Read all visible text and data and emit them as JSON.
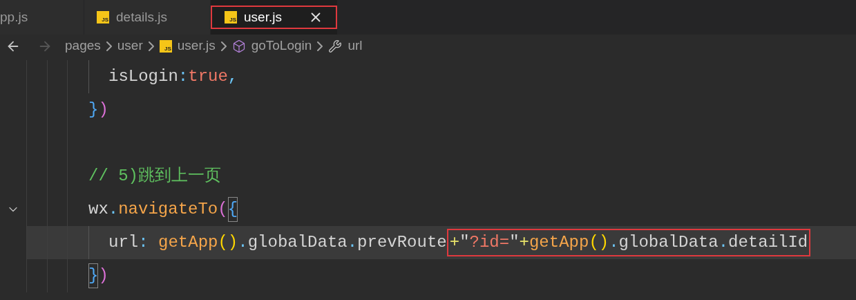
{
  "tabs": [
    {
      "label": "pp.js",
      "selected": false,
      "outlined": false
    },
    {
      "label": "details.js",
      "icon_label": "JS",
      "selected": false,
      "outlined": false
    },
    {
      "label": "user.js",
      "icon_label": "JS",
      "selected": true,
      "outlined": true
    }
  ],
  "nav": {
    "back_disabled": false,
    "forward_disabled": true
  },
  "breadcrumbs": [
    {
      "label": "pages",
      "kind": "folder"
    },
    {
      "label": "user",
      "kind": "folder"
    },
    {
      "label": "user.js",
      "kind": "file",
      "icon_label": "JS"
    },
    {
      "label": "goToLogin",
      "kind": "method"
    },
    {
      "label": "url",
      "kind": "property"
    }
  ],
  "code_lines": [
    {
      "kind": "code",
      "tokens": [
        {
          "kind": "indent"
        },
        {
          "kind": "plain",
          "text": "isLogin"
        },
        {
          "kind": "punct",
          "text": ":"
        },
        {
          "kind": "keyword",
          "text": "true"
        },
        {
          "kind": "punct",
          "text": ","
        }
      ]
    },
    {
      "kind": "code",
      "tokens": [
        {
          "kind": "b3",
          "text": "}"
        },
        {
          "kind": "b2",
          "text": ")"
        }
      ]
    },
    {
      "kind": "blank"
    },
    {
      "kind": "code",
      "tokens": [
        {
          "kind": "comment",
          "text": "// 5)跳到上一页"
        }
      ]
    },
    {
      "kind": "code",
      "fold": true,
      "tokens": [
        {
          "kind": "plain",
          "text": "wx"
        },
        {
          "kind": "punct",
          "text": "."
        },
        {
          "kind": "func",
          "text": "navigateTo"
        },
        {
          "kind": "b2",
          "text": "("
        },
        {
          "kind": "b3",
          "text": "{",
          "matched": true
        }
      ]
    },
    {
      "kind": "code",
      "current": true,
      "tokens": [
        {
          "kind": "indent"
        },
        {
          "kind": "plain",
          "text": "url"
        },
        {
          "kind": "punct",
          "text": ": "
        },
        {
          "kind": "func",
          "text": "getApp"
        },
        {
          "kind": "b1",
          "text": "()"
        },
        {
          "kind": "punct",
          "text": "."
        },
        {
          "kind": "plain",
          "text": "globalData"
        },
        {
          "kind": "punct",
          "text": "."
        },
        {
          "kind": "plain",
          "text": "prevRoute"
        },
        {
          "kind": "group",
          "outlined": true,
          "tokens": [
            {
              "kind": "op",
              "text": "+"
            },
            {
              "kind": "plain",
              "text": "\""
            },
            {
              "kind": "string",
              "text": "?id="
            },
            {
              "kind": "plain",
              "text": "\""
            },
            {
              "kind": "op",
              "text": "+"
            },
            {
              "kind": "func",
              "text": "getApp"
            },
            {
              "kind": "b1",
              "text": "()"
            },
            {
              "kind": "punct",
              "text": "."
            },
            {
              "kind": "plain",
              "text": "globalData"
            },
            {
              "kind": "punct",
              "text": "."
            },
            {
              "kind": "plain",
              "text": "detailId"
            }
          ]
        }
      ]
    },
    {
      "kind": "code",
      "tokens": [
        {
          "kind": "b3",
          "text": "}",
          "matched": true
        },
        {
          "kind": "b2",
          "text": ")"
        }
      ]
    }
  ]
}
